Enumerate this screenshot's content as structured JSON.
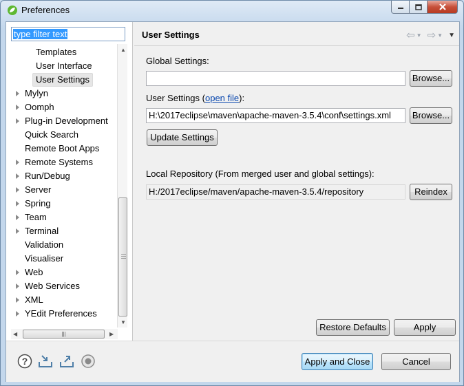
{
  "window": {
    "title": "Preferences",
    "controls": {
      "minimize_icon": "minimize-icon",
      "maximize_icon": "maximize-icon",
      "close_icon": "close-icon"
    }
  },
  "filter": {
    "value": "type filter text"
  },
  "tree": {
    "items": [
      {
        "label": "Templates",
        "indent": 2,
        "expandable": false,
        "selected": false
      },
      {
        "label": "User Interface",
        "indent": 2,
        "expandable": false,
        "selected": false
      },
      {
        "label": "User Settings",
        "indent": 2,
        "expandable": false,
        "selected": true
      },
      {
        "label": "Mylyn",
        "indent": 1,
        "expandable": true,
        "selected": false
      },
      {
        "label": "Oomph",
        "indent": 1,
        "expandable": true,
        "selected": false
      },
      {
        "label": "Plug-in Development",
        "indent": 1,
        "expandable": true,
        "selected": false
      },
      {
        "label": "Quick Search",
        "indent": 1,
        "expandable": false,
        "selected": false
      },
      {
        "label": "Remote Boot Apps",
        "indent": 1,
        "expandable": false,
        "selected": false
      },
      {
        "label": "Remote Systems",
        "indent": 1,
        "expandable": true,
        "selected": false
      },
      {
        "label": "Run/Debug",
        "indent": 1,
        "expandable": true,
        "selected": false
      },
      {
        "label": "Server",
        "indent": 1,
        "expandable": true,
        "selected": false
      },
      {
        "label": "Spring",
        "indent": 1,
        "expandable": true,
        "selected": false
      },
      {
        "label": "Team",
        "indent": 1,
        "expandable": true,
        "selected": false
      },
      {
        "label": "Terminal",
        "indent": 1,
        "expandable": true,
        "selected": false
      },
      {
        "label": "Validation",
        "indent": 1,
        "expandable": false,
        "selected": false
      },
      {
        "label": "Visualiser",
        "indent": 1,
        "expandable": false,
        "selected": false
      },
      {
        "label": "Web",
        "indent": 1,
        "expandable": true,
        "selected": false
      },
      {
        "label": "Web Services",
        "indent": 1,
        "expandable": true,
        "selected": false
      },
      {
        "label": "XML",
        "indent": 1,
        "expandable": true,
        "selected": false
      },
      {
        "label": "YEdit Preferences",
        "indent": 1,
        "expandable": true,
        "selected": false
      }
    ]
  },
  "page": {
    "title": "User Settings",
    "global_settings_label": "Global Settings:",
    "global_settings_value": "",
    "browse_label": "Browse...",
    "user_settings_label_prefix": "User Settings (",
    "user_settings_link": "open file",
    "user_settings_label_suffix": "):",
    "user_settings_value": "H:\\2017eclipse\\maven\\apache-maven-3.5.4\\conf\\settings.xml",
    "update_settings_label": "Update Settings",
    "local_repo_label": "Local Repository (From merged user and global settings):",
    "local_repo_value": "H:/2017eclipse/maven/apache-maven-3.5.4/repository",
    "reindex_label": "Reindex",
    "restore_defaults_label": "Restore Defaults",
    "apply_label": "Apply"
  },
  "footer": {
    "apply_close_label": "Apply and Close",
    "cancel_label": "Cancel"
  },
  "colors": {
    "accent": "#3399ff",
    "link": "#0645ad",
    "title_bar": "#c3d7ec",
    "close_button": "#c7503a"
  }
}
